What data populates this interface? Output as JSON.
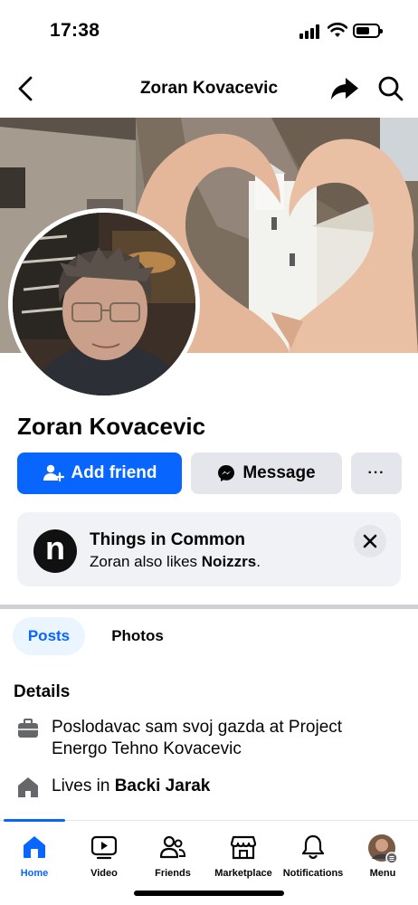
{
  "status_bar": {
    "time": "17:38"
  },
  "header": {
    "title": "Zoran Kovacevic"
  },
  "profile": {
    "name": "Zoran Kovacevic",
    "add_friend_label": "Add friend",
    "message_label": "Message",
    "more_label": "···"
  },
  "things_in_common": {
    "logo_letter": "n",
    "title": "Things in Common",
    "text_prefix": "Zoran also likes ",
    "liked_page": "Noizzrs",
    "text_suffix": "."
  },
  "tabs": [
    {
      "label": "Posts",
      "active": true
    },
    {
      "label": "Photos",
      "active": false
    }
  ],
  "details": {
    "heading": "Details",
    "work_line1": "Poslodavac sam svoj gazda at Project",
    "work_line2": "Energo Tehno Kovacevic",
    "lives_prefix": "Lives in ",
    "lives_city": "Backi Jarak"
  },
  "bottom_nav": [
    {
      "label": "Home",
      "icon": "home-icon",
      "active": true
    },
    {
      "label": "Video",
      "icon": "video-icon",
      "active": false
    },
    {
      "label": "Friends",
      "icon": "friends-icon",
      "active": false
    },
    {
      "label": "Marketplace",
      "icon": "marketplace-icon",
      "active": false
    },
    {
      "label": "Notifications",
      "icon": "bell-icon",
      "active": false
    },
    {
      "label": "Menu",
      "icon": "menu-avatar-icon",
      "active": false
    }
  ],
  "colors": {
    "accent": "#0866ff",
    "button_gray": "#e4e6eb",
    "card_bg": "#f0f2f5"
  }
}
